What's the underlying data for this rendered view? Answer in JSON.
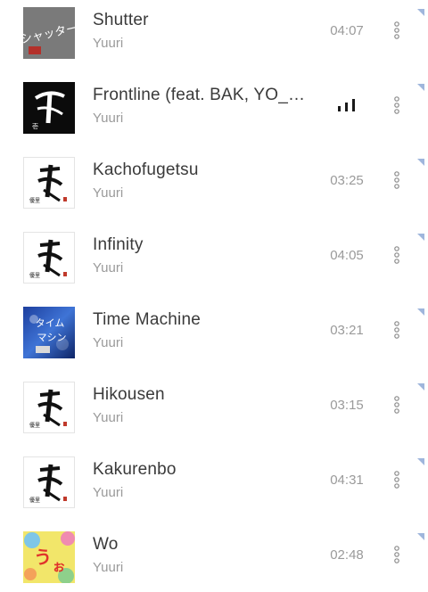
{
  "tracks": [
    {
      "title": "Shutter",
      "artist": "Yuuri",
      "duration": "04:07",
      "playing": false,
      "cover_icon": "shutter-cover-art",
      "cover_text": "シャッター"
    },
    {
      "title": "Frontline (feat. BAK, YO_…",
      "artist": "Yuuri",
      "duration": "",
      "playing": true,
      "cover_icon": "frontline-cover-art",
      "cover_text": "武"
    },
    {
      "title": "Kachofugetsu",
      "artist": "Yuuri",
      "duration": "03:25",
      "playing": false,
      "cover_icon": "album-calligraphy-cover-art",
      "cover_text": "壱"
    },
    {
      "title": "Infinity",
      "artist": "Yuuri",
      "duration": "04:05",
      "playing": false,
      "cover_icon": "album-calligraphy-cover-art",
      "cover_text": "壱"
    },
    {
      "title": "Time Machine",
      "artist": "Yuuri",
      "duration": "03:21",
      "playing": false,
      "cover_icon": "time-machine-cover-art",
      "cover_text": "タイムマシン"
    },
    {
      "title": "Hikousen",
      "artist": "Yuuri",
      "duration": "03:15",
      "playing": false,
      "cover_icon": "album-calligraphy-cover-art",
      "cover_text": "壱"
    },
    {
      "title": "Kakurenbo",
      "artist": "Yuuri",
      "duration": "04:31",
      "playing": false,
      "cover_icon": "album-calligraphy-cover-art",
      "cover_text": "壱"
    },
    {
      "title": "Wo",
      "artist": "Yuuri",
      "duration": "02:48",
      "playing": false,
      "cover_icon": "wo-cover-art",
      "cover_text": "うぉ"
    }
  ],
  "colors": {
    "title": "#3a3a3a",
    "secondary": "#9a9a9a",
    "corner_mark": "#9fb6dc",
    "playing_bars": "#1a1a1a"
  }
}
